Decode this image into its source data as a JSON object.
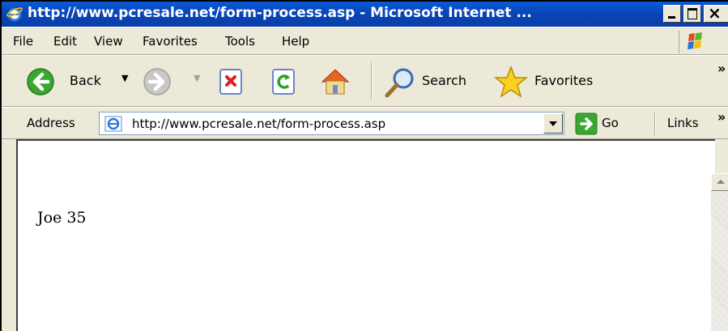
{
  "window": {
    "title": "http://www.pcresale.net/form-process.asp - Microsoft Internet ...",
    "close_glyph": "×"
  },
  "menu": {
    "items": [
      "File",
      "Edit",
      "View",
      "Favorites",
      "Tools",
      "Help"
    ]
  },
  "toolbar": {
    "back_label": "Back",
    "search_label": "Search",
    "favorites_label": "Favorites",
    "overflow_glyph": "»"
  },
  "addressbar": {
    "label": "Address",
    "value": "http://www.pcresale.net/form-process.asp",
    "go_label": "Go",
    "links_label": "Links",
    "overflow_glyph": "»"
  },
  "page": {
    "text": "Joe 35"
  },
  "colors": {
    "titlebar": "#0a4ec7",
    "chrome": "#ece9d8",
    "back_green": "#3aa830"
  }
}
